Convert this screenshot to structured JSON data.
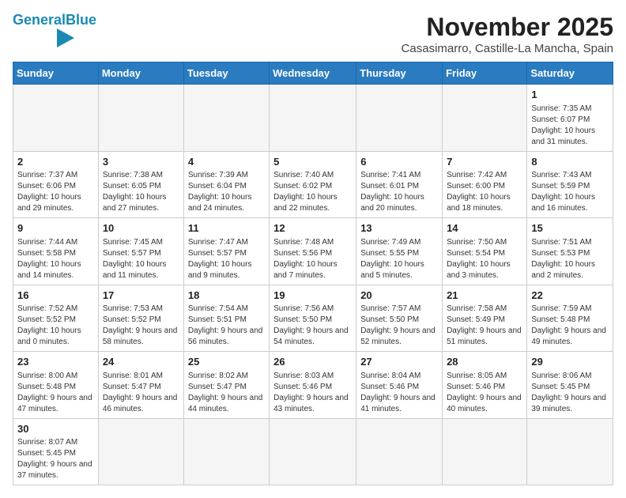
{
  "header": {
    "logo_general": "General",
    "logo_blue": "Blue",
    "title": "November 2025",
    "subtitle": "Casasimarro, Castille-La Mancha, Spain"
  },
  "days_of_week": [
    "Sunday",
    "Monday",
    "Tuesday",
    "Wednesday",
    "Thursday",
    "Friday",
    "Saturday"
  ],
  "weeks": [
    [
      {
        "day": "",
        "info": ""
      },
      {
        "day": "",
        "info": ""
      },
      {
        "day": "",
        "info": ""
      },
      {
        "day": "",
        "info": ""
      },
      {
        "day": "",
        "info": ""
      },
      {
        "day": "",
        "info": ""
      },
      {
        "day": "1",
        "info": "Sunrise: 7:35 AM\nSunset: 6:07 PM\nDaylight: 10 hours and 31 minutes."
      }
    ],
    [
      {
        "day": "2",
        "info": "Sunrise: 7:37 AM\nSunset: 6:06 PM\nDaylight: 10 hours and 29 minutes."
      },
      {
        "day": "3",
        "info": "Sunrise: 7:38 AM\nSunset: 6:05 PM\nDaylight: 10 hours and 27 minutes."
      },
      {
        "day": "4",
        "info": "Sunrise: 7:39 AM\nSunset: 6:04 PM\nDaylight: 10 hours and 24 minutes."
      },
      {
        "day": "5",
        "info": "Sunrise: 7:40 AM\nSunset: 6:02 PM\nDaylight: 10 hours and 22 minutes."
      },
      {
        "day": "6",
        "info": "Sunrise: 7:41 AM\nSunset: 6:01 PM\nDaylight: 10 hours and 20 minutes."
      },
      {
        "day": "7",
        "info": "Sunrise: 7:42 AM\nSunset: 6:00 PM\nDaylight: 10 hours and 18 minutes."
      },
      {
        "day": "8",
        "info": "Sunrise: 7:43 AM\nSunset: 5:59 PM\nDaylight: 10 hours and 16 minutes."
      }
    ],
    [
      {
        "day": "9",
        "info": "Sunrise: 7:44 AM\nSunset: 5:58 PM\nDaylight: 10 hours and 14 minutes."
      },
      {
        "day": "10",
        "info": "Sunrise: 7:45 AM\nSunset: 5:57 PM\nDaylight: 10 hours and 11 minutes."
      },
      {
        "day": "11",
        "info": "Sunrise: 7:47 AM\nSunset: 5:57 PM\nDaylight: 10 hours and 9 minutes."
      },
      {
        "day": "12",
        "info": "Sunrise: 7:48 AM\nSunset: 5:56 PM\nDaylight: 10 hours and 7 minutes."
      },
      {
        "day": "13",
        "info": "Sunrise: 7:49 AM\nSunset: 5:55 PM\nDaylight: 10 hours and 5 minutes."
      },
      {
        "day": "14",
        "info": "Sunrise: 7:50 AM\nSunset: 5:54 PM\nDaylight: 10 hours and 3 minutes."
      },
      {
        "day": "15",
        "info": "Sunrise: 7:51 AM\nSunset: 5:53 PM\nDaylight: 10 hours and 2 minutes."
      }
    ],
    [
      {
        "day": "16",
        "info": "Sunrise: 7:52 AM\nSunset: 5:52 PM\nDaylight: 10 hours and 0 minutes."
      },
      {
        "day": "17",
        "info": "Sunrise: 7:53 AM\nSunset: 5:52 PM\nDaylight: 9 hours and 58 minutes."
      },
      {
        "day": "18",
        "info": "Sunrise: 7:54 AM\nSunset: 5:51 PM\nDaylight: 9 hours and 56 minutes."
      },
      {
        "day": "19",
        "info": "Sunrise: 7:56 AM\nSunset: 5:50 PM\nDaylight: 9 hours and 54 minutes."
      },
      {
        "day": "20",
        "info": "Sunrise: 7:57 AM\nSunset: 5:50 PM\nDaylight: 9 hours and 52 minutes."
      },
      {
        "day": "21",
        "info": "Sunrise: 7:58 AM\nSunset: 5:49 PM\nDaylight: 9 hours and 51 minutes."
      },
      {
        "day": "22",
        "info": "Sunrise: 7:59 AM\nSunset: 5:48 PM\nDaylight: 9 hours and 49 minutes."
      }
    ],
    [
      {
        "day": "23",
        "info": "Sunrise: 8:00 AM\nSunset: 5:48 PM\nDaylight: 9 hours and 47 minutes."
      },
      {
        "day": "24",
        "info": "Sunrise: 8:01 AM\nSunset: 5:47 PM\nDaylight: 9 hours and 46 minutes."
      },
      {
        "day": "25",
        "info": "Sunrise: 8:02 AM\nSunset: 5:47 PM\nDaylight: 9 hours and 44 minutes."
      },
      {
        "day": "26",
        "info": "Sunrise: 8:03 AM\nSunset: 5:46 PM\nDaylight: 9 hours and 43 minutes."
      },
      {
        "day": "27",
        "info": "Sunrise: 8:04 AM\nSunset: 5:46 PM\nDaylight: 9 hours and 41 minutes."
      },
      {
        "day": "28",
        "info": "Sunrise: 8:05 AM\nSunset: 5:46 PM\nDaylight: 9 hours and 40 minutes."
      },
      {
        "day": "29",
        "info": "Sunrise: 8:06 AM\nSunset: 5:45 PM\nDaylight: 9 hours and 39 minutes."
      }
    ],
    [
      {
        "day": "30",
        "info": "Sunrise: 8:07 AM\nSunset: 5:45 PM\nDaylight: 9 hours and 37 minutes."
      },
      {
        "day": "",
        "info": ""
      },
      {
        "day": "",
        "info": ""
      },
      {
        "day": "",
        "info": ""
      },
      {
        "day": "",
        "info": ""
      },
      {
        "day": "",
        "info": ""
      },
      {
        "day": "",
        "info": ""
      }
    ]
  ]
}
